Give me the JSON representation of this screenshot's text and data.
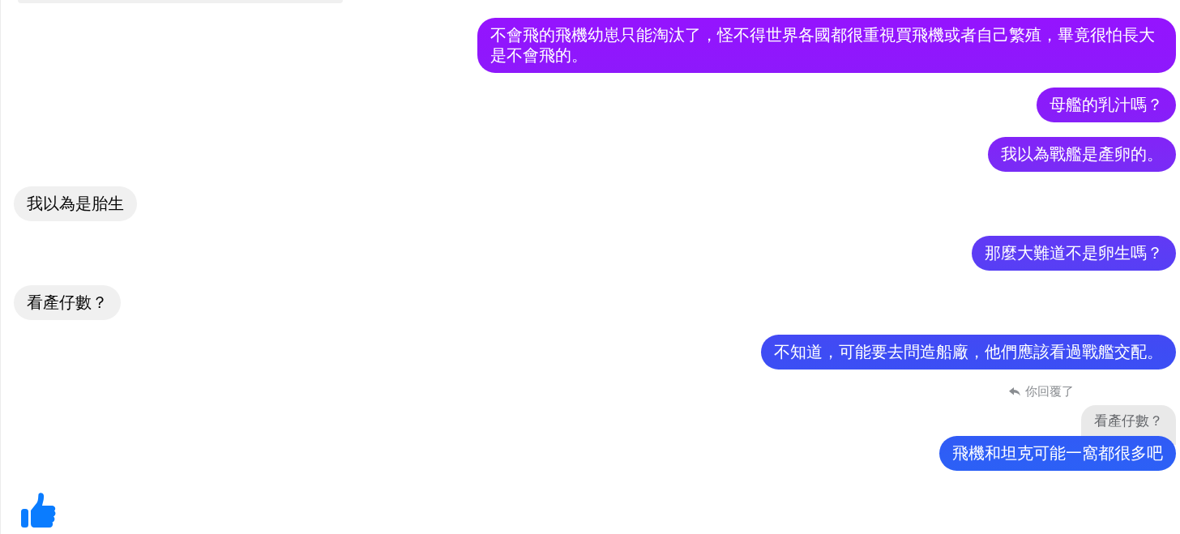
{
  "conversation": {
    "messages": [
      {
        "kind": "clipped",
        "outgoing": false
      },
      {
        "kind": "text",
        "outgoing": true,
        "text": "不會飛的飛機幼崽只能淘汰了，怪不得世界各國都很重視買飛機或者自己繁殖，畢竟很怕長大是不會飛的。"
      },
      {
        "kind": "text",
        "outgoing": true,
        "text": "母艦的乳汁嗎？"
      },
      {
        "kind": "text",
        "outgoing": true,
        "text": "我以為戰艦是產卵的。"
      },
      {
        "kind": "text",
        "outgoing": false,
        "text": "我以為是胎生"
      },
      {
        "kind": "text",
        "outgoing": true,
        "text": "那麼大難道不是卵生嗎？"
      },
      {
        "kind": "text",
        "outgoing": false,
        "text": "看產仔數？"
      },
      {
        "kind": "text",
        "outgoing": true,
        "text": "不知道，可能要去問造船廠，他們應該看過戰艦交配。"
      },
      {
        "kind": "reply",
        "outgoing": true,
        "reply_label": "你回覆了",
        "quoted": "看產仔數？",
        "text": "飛機和坦克可能一窩都很多吧"
      },
      {
        "kind": "like",
        "outgoing": false
      }
    ]
  }
}
